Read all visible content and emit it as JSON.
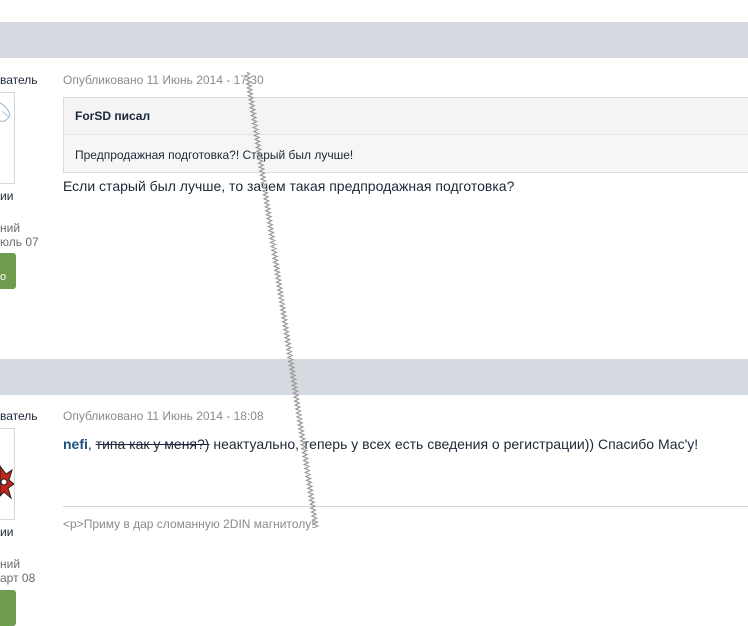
{
  "post1": {
    "author_role": "ватель",
    "posted_label": "Опубликовано 11 Июнь 2014 - 17:30",
    "side_group": "ии",
    "side_line1": "ний",
    "side_line2": "юль 07",
    "rep_label": "о",
    "quote": {
      "author": "ForSD писал",
      "text": "Предпродажная подготовка?! Старый был лучше!"
    },
    "message": "Если старый был лучше, то зачем такая предпродажная подготовка?"
  },
  "post2": {
    "author_role": "ватель",
    "posted_label": "Опубликовано 11 Июнь 2014 - 18:08",
    "side_group": "ии",
    "side_line1": "ний",
    "side_line2": "арт 08",
    "message_user": "nefi",
    "message_comma": ",",
    "message_strike": "типа как у меня?)",
    "message_rest": " неактуально, теперь у всех есть сведения о регистрации)) Спасибо Мас'у!",
    "signature": "<p>Приму в дар сломанную 2DIN магнитолу!"
  },
  "colors": {
    "header_bar": "#d5dae1",
    "rep_badge": "#6f9c4d",
    "username": "#1d4f80"
  }
}
